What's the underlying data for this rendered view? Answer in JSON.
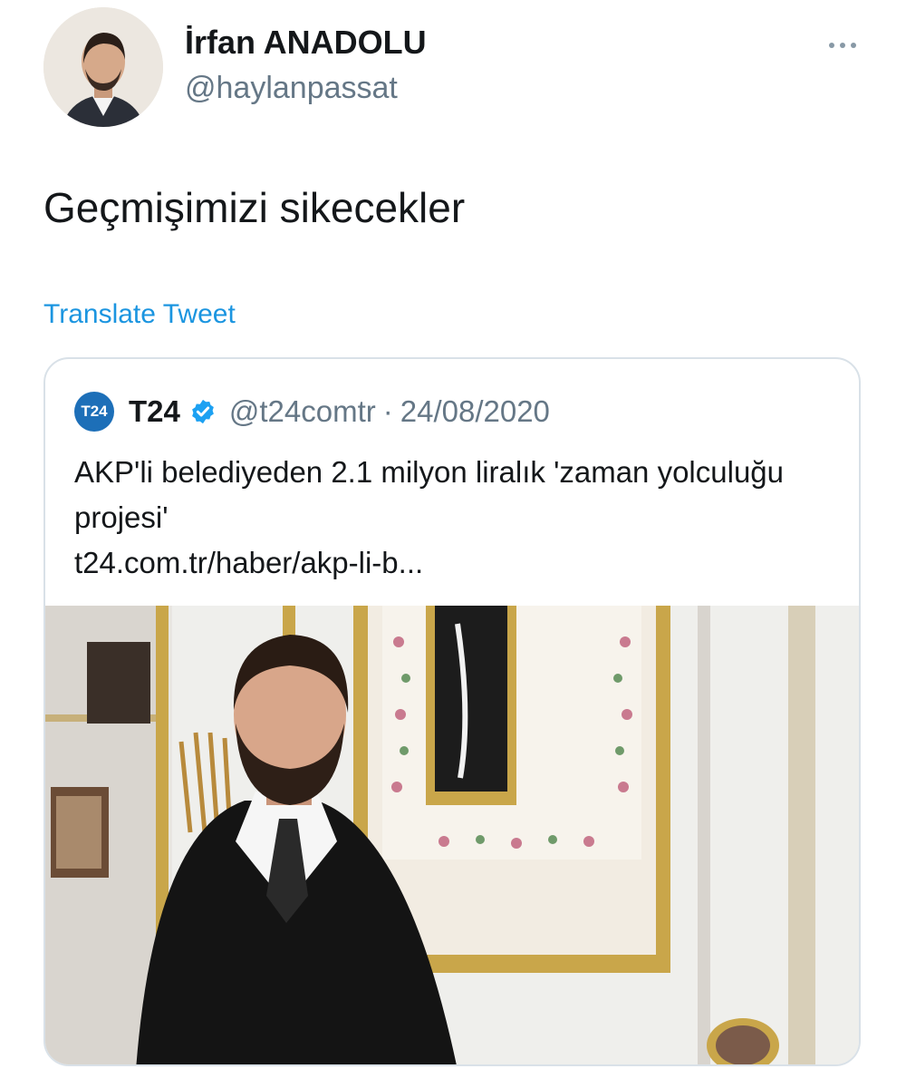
{
  "tweet": {
    "author": {
      "display_name": "İrfan ANADOLU",
      "handle": "@haylanpassat",
      "avatar_icon": "profile-photo"
    },
    "more_icon": "ellipsis-icon",
    "text": "Geçmişimizi sikecekler",
    "translate_label": "Translate Tweet"
  },
  "quoted_tweet": {
    "logo_text": "T24",
    "name": "T24",
    "verified_icon": "verified-badge-icon",
    "handle": "@t24comtr",
    "separator": "·",
    "date": "24/08/2020",
    "body_line1": "AKP'li belediyeden 2.1 milyon liralık 'zaman yolculuğu projesi'",
    "link": "t24.com.tr/haber/akp-li-b...",
    "image": "news-photo-bearded-man-in-front-of-framed-calligraphy"
  },
  "colors": {
    "link_blue": "#1b95e0",
    "verified_blue": "#1da1f2",
    "secondary_text": "#657786",
    "border": "#d9e1e8",
    "t24_logo": "#1d6fb8"
  }
}
